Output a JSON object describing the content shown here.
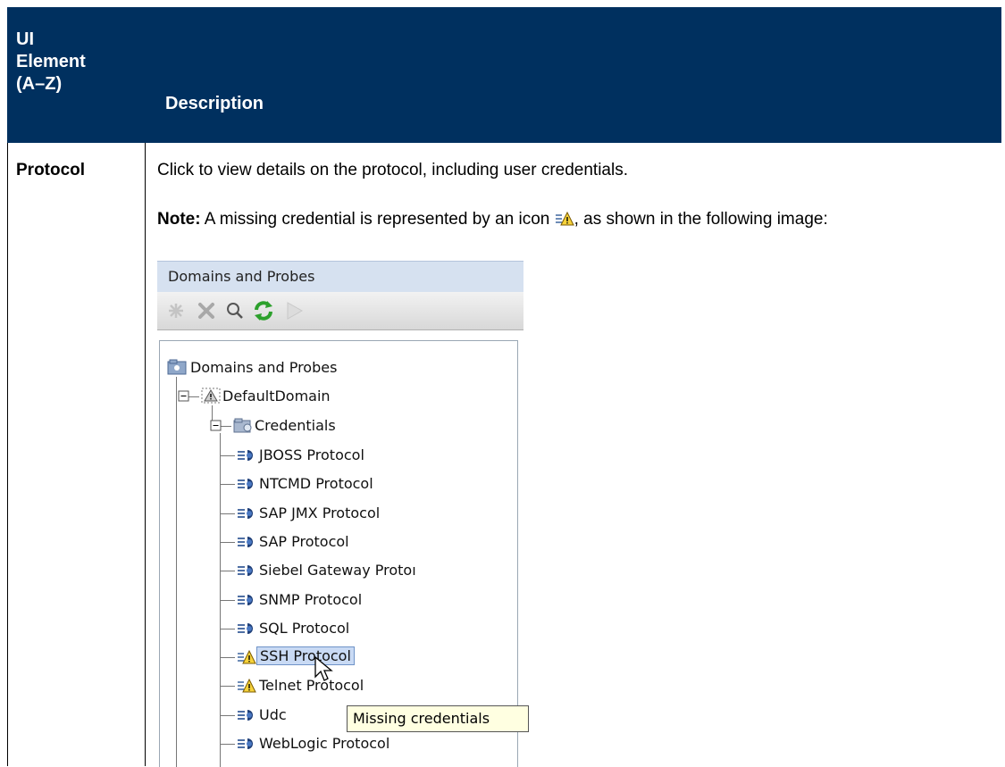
{
  "header": {
    "col1": "UI Element (A–Z)",
    "col2": "Description"
  },
  "row": {
    "name": "Protocol",
    "description": "Click to view details on the protocol, including user credentials.",
    "note_label": "Note:",
    "note_text_before": " A missing credential is represented by an icon ",
    "note_text_after": ", as shown in the following image:"
  },
  "screenshot": {
    "panel_title": "Domains and Probes",
    "toolbar": [
      "new-icon",
      "delete-icon",
      "search-icon",
      "refresh-icon",
      "play-icon"
    ],
    "tree": {
      "root": "Domains and Probes",
      "domain": "DefaultDomain",
      "folder": "Credentials",
      "items": [
        {
          "label": "JBOSS Protocol",
          "missing": false
        },
        {
          "label": "NTCMD Protocol",
          "missing": false
        },
        {
          "label": "SAP JMX Protocol",
          "missing": false
        },
        {
          "label": "SAP Protocol",
          "missing": false
        },
        {
          "label": "Siebel Gateway Protoı",
          "missing": false
        },
        {
          "label": "SNMP Protocol",
          "missing": false
        },
        {
          "label": "SQL Protocol",
          "missing": false
        },
        {
          "label": "SSH Protocol",
          "missing": true,
          "selected": true
        },
        {
          "label": "Telnet Protocol",
          "missing": true
        },
        {
          "label": "Udc",
          "missing": false
        },
        {
          "label": "WebLogic Protocol",
          "missing": false
        }
      ]
    },
    "tooltip": "Missing credentials"
  }
}
